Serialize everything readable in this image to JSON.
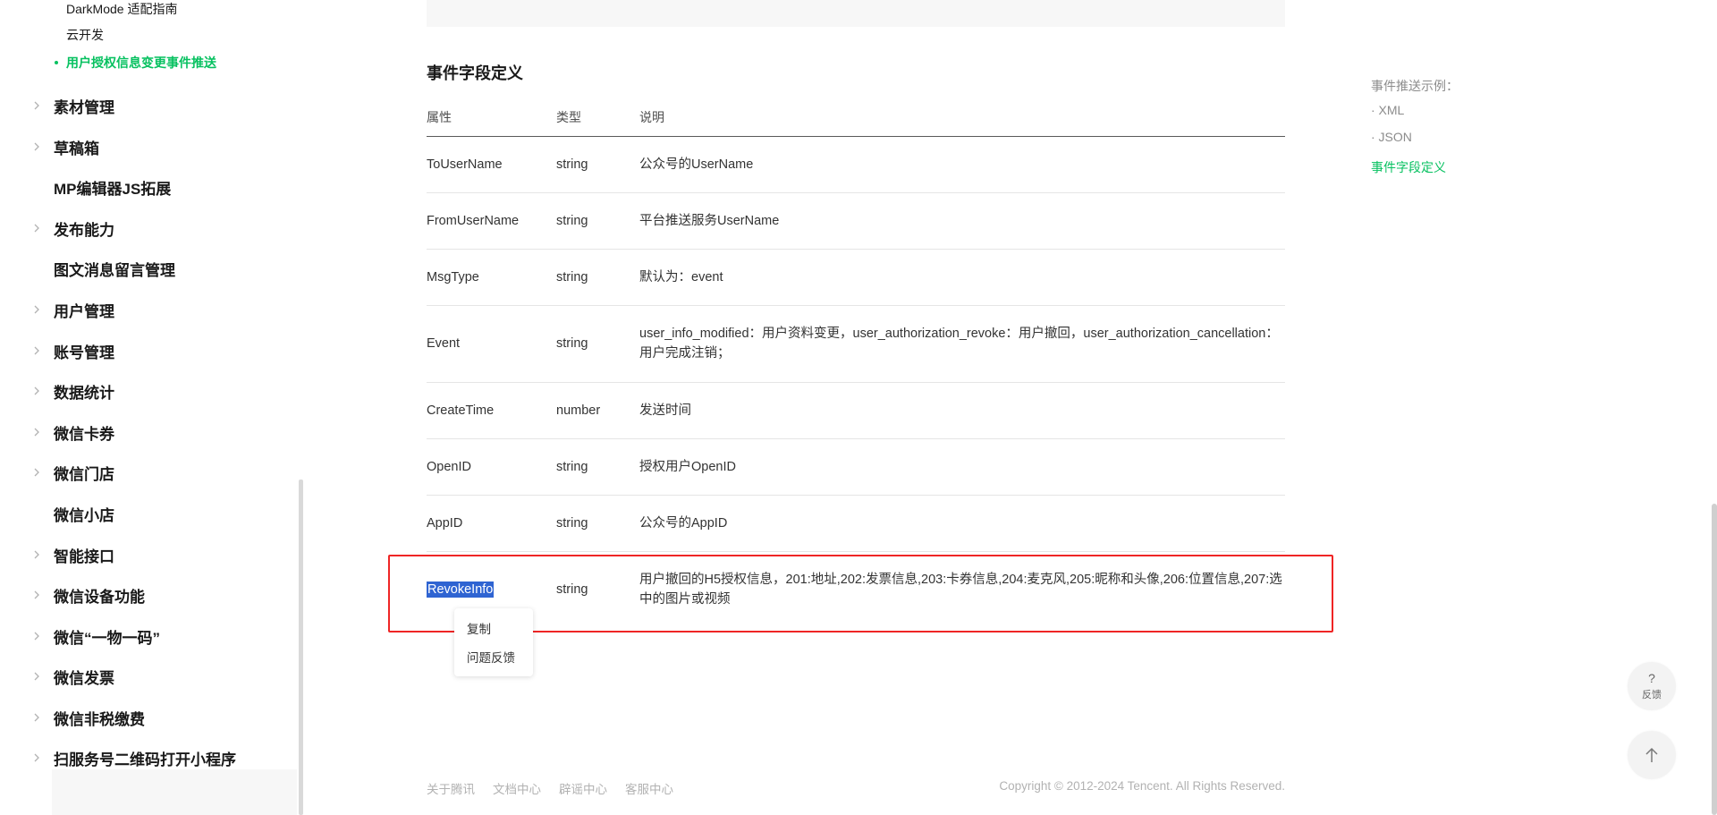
{
  "sidebar": {
    "sub_items": [
      {
        "label": "DarkMode 适配指南"
      },
      {
        "label": "云开发"
      },
      {
        "label": "用户授权信息变更事件推送"
      }
    ],
    "items": [
      {
        "label": "素材管理"
      },
      {
        "label": "草稿箱"
      },
      {
        "label": "MP编辑器JS拓展"
      },
      {
        "label": "发布能力"
      },
      {
        "label": "图文消息留言管理"
      },
      {
        "label": "用户管理"
      },
      {
        "label": "账号管理"
      },
      {
        "label": "数据统计"
      },
      {
        "label": "微信卡券"
      },
      {
        "label": "微信门店"
      },
      {
        "label": "微信小店"
      },
      {
        "label": "智能接口"
      },
      {
        "label": "微信设备功能"
      },
      {
        "label": "微信“一物一码”"
      },
      {
        "label": "微信发票"
      },
      {
        "label": "微信非税缴费"
      },
      {
        "label": "扫服务号二维码打开小程序"
      }
    ]
  },
  "main": {
    "section_title": "事件字段定义",
    "table": {
      "headers": [
        "属性",
        "类型",
        "说明"
      ],
      "rows": [
        {
          "name": "ToUserName",
          "type": "string",
          "desc": "公众号的UserName"
        },
        {
          "name": "FromUserName",
          "type": "string",
          "desc": "平台推送服务UserName"
        },
        {
          "name": "MsgType",
          "type": "string",
          "desc": "默认为：event"
        },
        {
          "name": "Event",
          "type": "string",
          "desc": "user_info_modified：用户资料变更，user_authorization_revoke：用户撤回，user_authorization_cancellation：用户完成注销；"
        },
        {
          "name": "CreateTime",
          "type": "number",
          "desc": "发送时间"
        },
        {
          "name": "OpenID",
          "type": "string",
          "desc": "授权用户OpenID"
        },
        {
          "name": "AppID",
          "type": "string",
          "desc": "公众号的AppID"
        },
        {
          "name": "RevokeInfo",
          "type": "string",
          "desc": "用户撤回的H5授权信息，201:地址,202:发票信息,203:卡券信息,204:麦克风,205:昵称和头像,206:位置信息,207:选中的图片或视频"
        }
      ]
    },
    "context_menu": {
      "items": [
        "复制",
        "问题反馈"
      ]
    }
  },
  "toc": {
    "title": "事件推送示例：",
    "items": [
      "· XML",
      "· JSON",
      "事件字段定义"
    ]
  },
  "footer": {
    "links": [
      "关于腾讯",
      "文档中心",
      "辟谣中心",
      "客服中心"
    ],
    "copyright": "Copyright © 2012-2024 Tencent. All Rights Reserved."
  },
  "floating": {
    "feedback_symbol": "?",
    "feedback_label": "反馈"
  },
  "colors": {
    "accent": "#07c160",
    "highlight_border": "#ef2525",
    "selection": "#2f64d2"
  }
}
